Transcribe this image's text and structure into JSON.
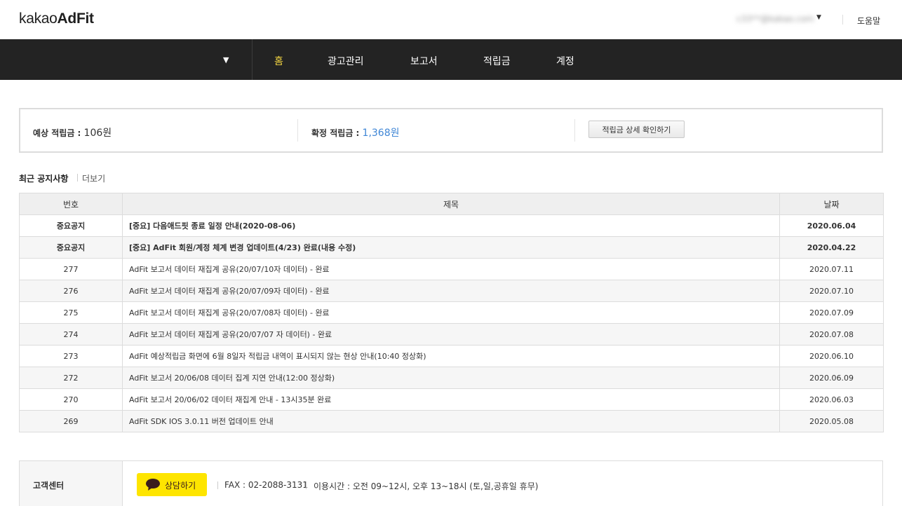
{
  "header": {
    "logo_light": "kakao",
    "logo_bold": "AdFit",
    "account": "c33**@kakao.com",
    "help": "도움말"
  },
  "nav": {
    "items": [
      {
        "label": "홈",
        "active": true
      },
      {
        "label": "광고관리"
      },
      {
        "label": "보고서"
      },
      {
        "label": "적립금"
      },
      {
        "label": "계정"
      }
    ]
  },
  "summary": {
    "expected_label": "예상 적립금 :",
    "expected_value": "106원",
    "confirmed_label": "확정 적립금 :",
    "confirmed_value": "1,368원",
    "detail_button": "적립금 상세 확인하기"
  },
  "notices": {
    "title": "최근 공지사항",
    "more": "더보기",
    "columns": [
      "번호",
      "제목",
      "날짜"
    ],
    "rows": [
      {
        "no": "중요공지",
        "title": "[중요] 다음애드핏 종료 일정 안내(2020-08-06)",
        "date": "2020.06.04"
      },
      {
        "no": "중요공지",
        "title": "[중요] AdFit 회원/계정 체계 변경 업데이트(4/23) 완료(내용 수정)",
        "date": "2020.04.22"
      },
      {
        "no": "277",
        "title": "AdFit 보고서 데이터 재집계 공유(20/07/10자 데이터) - 완료",
        "date": "2020.07.11"
      },
      {
        "no": "276",
        "title": "AdFit 보고서 데이터 재집계 공유(20/07/09자 데이터) - 완료",
        "date": "2020.07.10"
      },
      {
        "no": "275",
        "title": "AdFit 보고서 데이터 재집계 공유(20/07/08자 데이터) - 완료",
        "date": "2020.07.09"
      },
      {
        "no": "274",
        "title": "AdFit 보고서 데이터 재집계 공유(20/07/07 자 데이터) - 완료",
        "date": "2020.07.08"
      },
      {
        "no": "273",
        "title": "AdFit 예상적립금 화면에 6월 8일자 적립금 내역이 표시되지 않는 현상 안내(10:40 정상화)",
        "date": "2020.06.10"
      },
      {
        "no": "272",
        "title": "AdFit 보고서 20/06/08 데이터 집계 지연 안내(12:00 정상화)",
        "date": "2020.06.09"
      },
      {
        "no": "270",
        "title": "AdFit 보고서 20/06/02 데이터 재집계 안내 - 13시35분 완료",
        "date": "2020.06.03"
      },
      {
        "no": "269",
        "title": "AdFit SDK IOS 3.0.11 버전 업데이트 안내",
        "date": "2020.05.08"
      }
    ]
  },
  "customer_center": {
    "label": "고객센터",
    "chat_button": "상담하기",
    "fax": "FAX : 02-2088-3131",
    "hours": "이용시간 : 오전 09~12시, 오후 13~18시 (토,일,공휴일 휴무)"
  },
  "colors": {
    "nav_bg": "#232323",
    "nav_active": "#f5d742",
    "confirmed_value": "#3f86d6",
    "chat_button": "#fee500"
  },
  "icons": [
    "caret-down-icon",
    "speech-bubble-icon"
  ]
}
